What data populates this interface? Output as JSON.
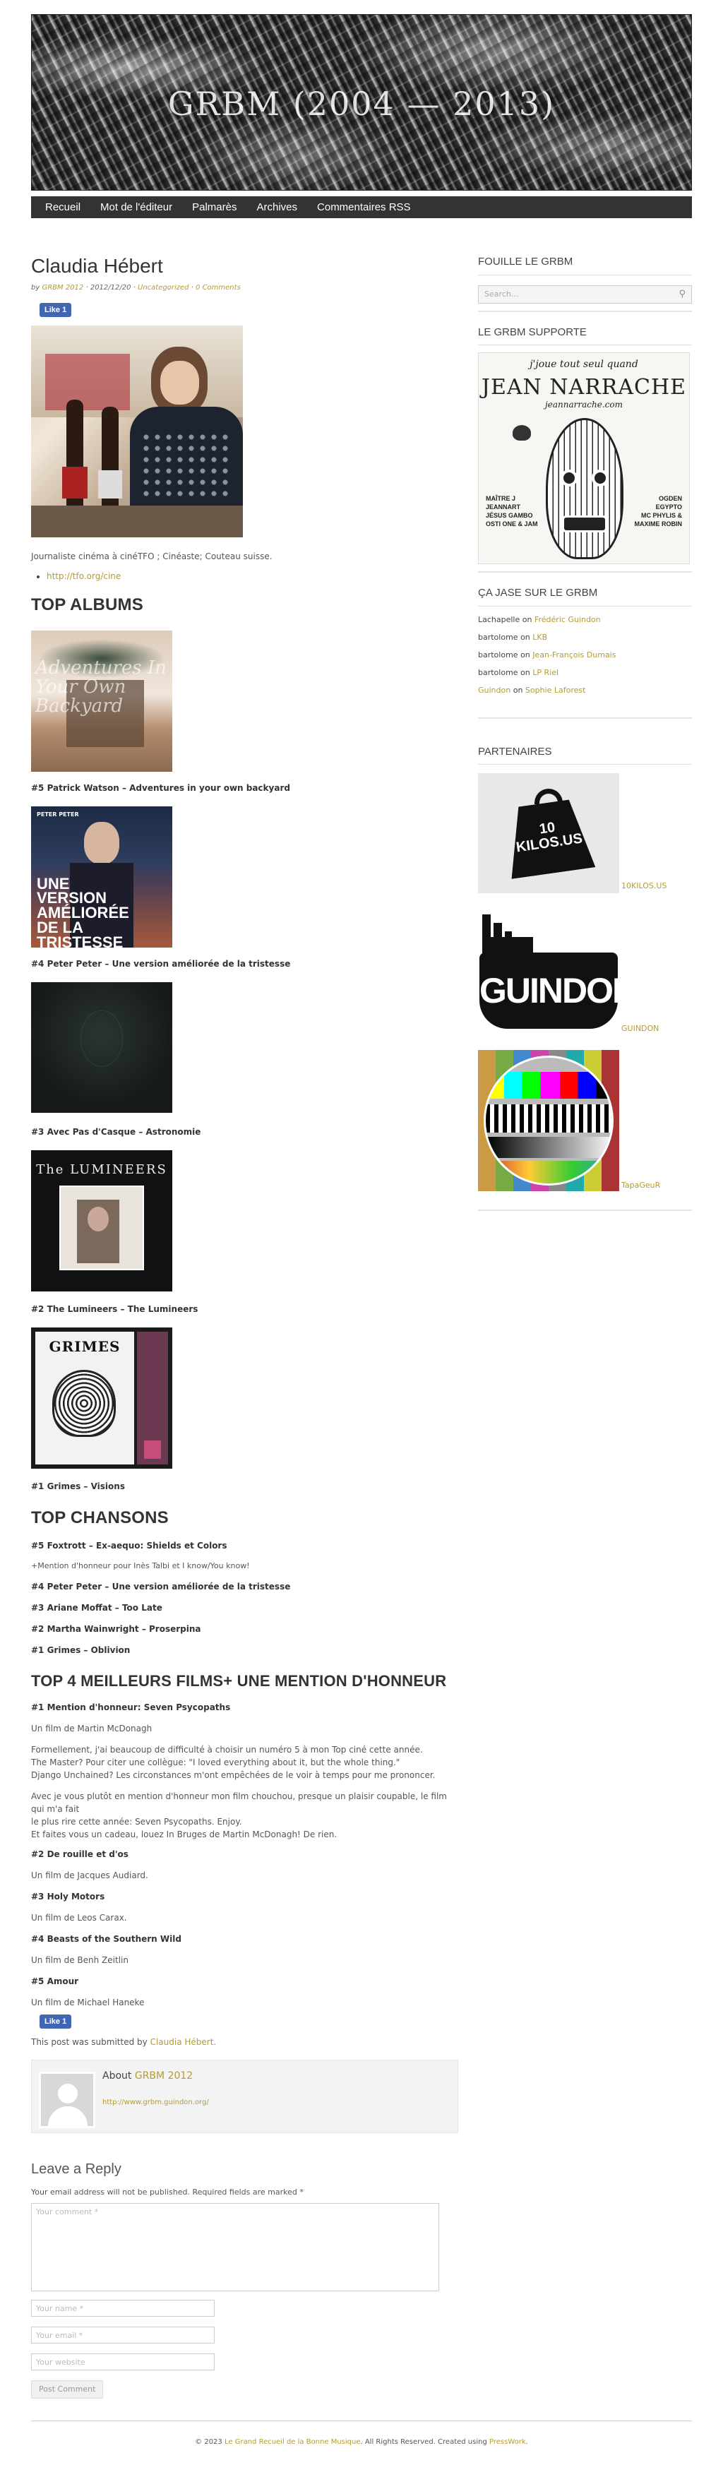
{
  "site": {
    "title": "GRBM (2004 — 2013)"
  },
  "nav": [
    "Recueil",
    "Mot de l'éditeur",
    "Palmarès",
    "Archives",
    "Commentaires RSS"
  ],
  "post": {
    "title": "Claudia Hébert",
    "meta": {
      "by": "by",
      "author": "GRBM 2012",
      "date": "2012/12/20",
      "category": "Uncategorized",
      "comments": "0 Comments"
    },
    "like": "Like 1",
    "bio": "Journaliste cinéma à cinéTFO ; Cinéaste; Couteau suisse.",
    "link": "http://tfo.org/cine",
    "top_albums_title": "TOP ALBUMS",
    "albums": [
      "#5 Patrick Watson – Adventures in your own backyard",
      "#4 Peter Peter – Une version améliorée de la tristesse",
      "#3 Avec Pas d'Casque – Astronomie",
      "#2 The Lumineers – The Lumineers",
      "#1 Grimes – Visions"
    ],
    "album_art": {
      "watson": "Adventures In Your Own Backyard",
      "peter_label": "PETER PETER",
      "peter_title": "UNE VERSION AMÉLIORÉE DE LA TRISTESSE",
      "lumineers": "The LUMINEERS",
      "grimes": "GRIMES"
    },
    "top_chansons_title": "TOP CHANSONS",
    "chansons": [
      "#5 Foxtrott – Ex-aequo: Shields et Colors",
      "+Mention d'honneur pour Inès Talbi et I know/You know!",
      "#4 Peter Peter – Une version améliorée de la tristesse",
      "#3 Ariane Moffat – Too Late",
      "#2 Martha Wainwright – Proserpina",
      "#1 Grimes – Oblivion"
    ],
    "films_title": "TOP 4 MEILLEURS FILMS+ UNE MENTION D'HONNEUR",
    "films": {
      "h1": "#1 Mention d'honneur: Seven Psycopaths",
      "h1_by": "Un film de Martin McDonagh",
      "para1": [
        "Formellement, j'ai beaucoup de difficulté à choisir un numéro 5 à mon Top ciné cette année.",
        "The Master? Pour citer une collègue: \"I loved everything about it, but the whole thing.\"",
        "Django Unchained? Les circonstances m'ont empêchées de le voir à temps pour me prononcer."
      ],
      "para2": [
        "Avec je vous plutôt en mention d'honneur mon film chouchou, presque un plaisir coupable, le film qui m'a fait",
        "le plus rire cette année: Seven Psycopaths. Enjoy.",
        "Et faites vous un cadeau, louez In Bruges de Martin McDonagh! De rien."
      ],
      "f2": "#2 De rouille et d'os",
      "f2_by": "Un film de Jacques Audiard.",
      "f3": "#3 Holy Motors",
      "f3_by": "Un film de Leos Carax.",
      "f4": "#4 Beasts of the Southern Wild",
      "f4_by": "Un film de Benh Zeitlin",
      "f5": "#5 Amour",
      "f5_by": "Un film de Michael Haneke"
    },
    "submitted_prefix": "This post was submitted by",
    "submitted_name": "Claudia Hébert.",
    "about_prefix": "About",
    "about_name": "GRBM 2012",
    "about_link": "http://www.grbm.guindon.org/"
  },
  "reply": {
    "title": "Leave a Reply",
    "note": "Your email address will not be published. Required fields are marked *",
    "comment_ph": "Your comment *",
    "name_ph": "Your name *",
    "email_ph": "Your email *",
    "website_ph": "Your website",
    "submit": "Post Comment"
  },
  "sidebar": {
    "search_title": "FOUILLE LE GRBM",
    "search_ph": "Search...",
    "supporte_title": "LE GRBM SUPPORTE",
    "poster": {
      "top": "j'joue tout seul quand",
      "name": "JEAN NARRACHE",
      "url": "jeannarrache.com",
      "left": [
        "MAÎTRE J",
        "JEANNART",
        "JÉSUS GAMBO",
        "OSTI ONE & JAM"
      ],
      "right": [
        "OGDEN",
        "EGYPTO",
        "MC PHYLIS &",
        "MAXIME ROBIN"
      ]
    },
    "jase_title": "ÇA JASE SUR LE GRBM",
    "comments": [
      {
        "who": "Lachapelle",
        "on": "on",
        "post": "Frédéric Guindon"
      },
      {
        "who": "bartolome",
        "on": "on",
        "post": "LKB"
      },
      {
        "who": "bartolome",
        "on": "on",
        "post": "Jean-François Dumais"
      },
      {
        "who": "bartolome",
        "on": "on",
        "post": "LP Riel"
      },
      {
        "who": "Guindon",
        "on": "on",
        "post": "Sophie Laforest"
      }
    ],
    "partners_title": "PARTENAIRES",
    "partners": [
      "10KILOS.US",
      "GUINDON",
      "TapaGeuR"
    ],
    "kilos_text": "10 KILOS.US",
    "guindon_logo": "GUINDON"
  },
  "footer": {
    "prefix": "© 2023",
    "site": "Le Grand Recueil de la Bonne Musique",
    "mid": ". All Rights Reserved. Created using",
    "theme": "PressWork",
    "end": "."
  }
}
